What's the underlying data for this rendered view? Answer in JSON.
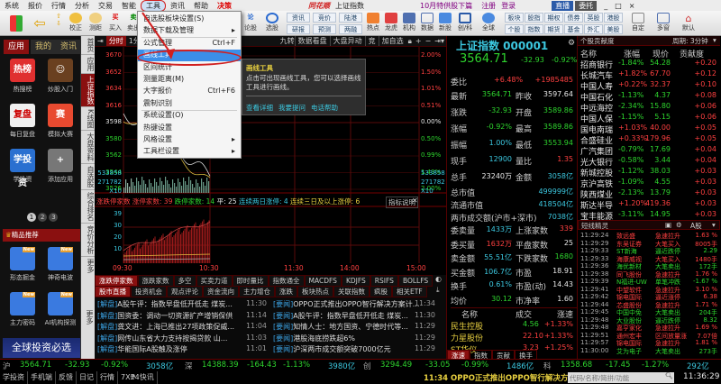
{
  "menu": {
    "items": [
      "系统",
      "报价",
      "行情",
      "分析",
      "交易",
      "智能",
      "工具",
      "资讯",
      "帮助"
    ],
    "special": "决策",
    "brand": "同花顺",
    "title": "上证指数",
    "promo": "10月特供股下篇",
    "register": "注册",
    "login": "登录",
    "live": "直播",
    "trade": "委托"
  },
  "toolbar": {
    "left": [
      "校正",
      "测距",
      "买入",
      "卖出"
    ],
    "mid1": [
      "论股",
      "选股"
    ],
    "small": [
      "资讯",
      "竞价",
      "陆港",
      "研报",
      "预测",
      "两融"
    ],
    "icons": [
      "热点",
      "龙虎",
      "机构",
      "数据",
      "新股",
      "创/科",
      "全球"
    ],
    "markets": [
      "板块",
      "股指",
      "期权",
      "债券",
      "英股",
      "港股",
      "个股",
      "指数",
      "期货",
      "基金",
      "外汇",
      "美股"
    ],
    "views": [
      "自定",
      "多窗",
      "默认"
    ]
  },
  "dropdown": {
    "items": [
      {
        "label": "自选股板块设置(S)",
        "sc": ""
      },
      {
        "label": "数据下载及管理",
        "sc": "▸"
      },
      {
        "label": "公式管理",
        "sc": "Ctrl+F"
      },
      {
        "label": "画线工具",
        "sc": ""
      },
      {
        "label": "区间统计",
        "sc": ""
      },
      {
        "label": "测量距离(M)",
        "sc": ""
      },
      {
        "label": "大字报价",
        "sc": "Ctrl+F6"
      },
      {
        "label": "震制识别",
        "sc": ""
      },
      {
        "label": "系统设置(O)",
        "sc": ""
      },
      {
        "label": "热键设置",
        "sc": ""
      },
      {
        "label": "风格设置",
        "sc": "▸"
      },
      {
        "label": "工具栏设置",
        "sc": "▸"
      }
    ]
  },
  "tooltip": {
    "title": "画线工具",
    "body": "点击可出现画线工具，您可以选择画线工具进行画线。",
    "links": [
      "查看详细",
      "我要提问",
      "电话帮助"
    ]
  },
  "left": {
    "tabs": [
      "应用",
      "我的",
      "资讯"
    ],
    "apps": [
      {
        "label": "热搜榜",
        "icon": "热榜",
        "color": "#e03030"
      },
      {
        "label": "炒股入门",
        "icon": "☺",
        "color": "#6a4020"
      },
      {
        "label": "每日复盘",
        "icon": "复盘",
        "color": "#f0f0f0"
      },
      {
        "label": "模拟大赛",
        "icon": "赛",
        "color": "#e84a30"
      },
      {
        "label": "学投资",
        "icon": "学投资",
        "color": "#2a70d0"
      },
      {
        "label": "添加应用",
        "icon": "+",
        "color": "#777"
      }
    ],
    "pages": [
      "1",
      "2",
      "3"
    ],
    "featured": "精品推荐",
    "recommend": [
      {
        "label": "形态掘金",
        "badge": "New"
      },
      {
        "label": "神奇电波",
        "badge": "New"
      },
      {
        "label": "主力密码",
        "badge": "New"
      },
      {
        "label": "AI机构探测",
        "badge": "New"
      }
    ],
    "banner": "全球投资必选"
  },
  "vtabs": [
    "首页",
    "应用",
    "上证指数",
    "K线图",
    "大盘资料",
    "自选股",
    "综合排名",
    "竞价分析",
    "更多"
  ],
  "chart": {
    "tabs": [
      "分时",
      "1分"
    ],
    "tools": [
      "九转",
      "数据看盘",
      "大盘异动",
      "竞",
      "加自选"
    ],
    "ylabels_left": [
      "3670",
      "3652",
      "3634",
      "3616",
      "3598",
      "3580",
      "3562",
      "3544",
      "3526"
    ],
    "ylabels_right": [
      "2.00%",
      "1.50%",
      "1.01%",
      "0.51%",
      "0.00%",
      "0.50%",
      "0.99%",
      "1.49%",
      "2.00%"
    ],
    "vol_labels": [
      "533858",
      "271782",
      "X10"
    ],
    "ind_labels": [
      "39",
      "30",
      "20",
      "10"
    ],
    "legend": {
      "name": "涨跌停家数",
      "up": "涨停家数: 39",
      "down": "跌停家数: 14",
      "flat": "平: 25",
      "two": "连续两日涨停: 4",
      "three": "连续三日及以上涨停: 6"
    },
    "explain": "指标说明",
    "times": [
      "09:30",
      "10:30",
      "11:30",
      "14:00",
      "15:00"
    ],
    "ind_tabs": [
      "涨跌停家数",
      "涨跌家数",
      "多空",
      "买卖力道",
      "即时量比",
      "指数通全",
      "MACDFS",
      "KDJFS",
      "RSIFS",
      "BOLLFS"
    ]
  },
  "news": {
    "side": "更多",
    "tabs_left": [
      "股市直播",
      "投资机会",
      "观点评论",
      "资金流向",
      "主力增仓",
      "短线"
    ],
    "tabs_right": [
      "涨跌",
      "板块热点",
      "关联指数",
      "疯股",
      "相关ETF"
    ],
    "left": [
      {
        "tag": "[解盘]",
        "text": "A股午评：指数早盘低开低走 煤炭...",
        "time": "11:30"
      },
      {
        "tag": "[解盘]",
        "text": "国资委：调动一切资源扩产增销保供",
        "time": "11:14"
      },
      {
        "tag": "[解盘]",
        "text": "龚文进：上海已推出27项政策促威...",
        "time": "11:04"
      },
      {
        "tag": "[解盘]",
        "text": "网传山东省大力支持按揭贷款 山...",
        "time": "11:03"
      },
      {
        "tag": "[解盘]",
        "text": "华能国际A股触及涨停",
        "time": "11:01"
      }
    ],
    "right": [
      {
        "tag": "[要闻]",
        "text": "OPPO正式推出OPPO智行解决方案计...",
        "time": "11:34"
      },
      {
        "tag": "[要闻]",
        "text": "A股午评：指数早盘低开低走 煤炭...",
        "time": "11:30"
      },
      {
        "tag": "[要闻]",
        "text": "知情人士：地方国资、宁德时代等...",
        "time": "11:29"
      },
      {
        "tag": "[要闻]",
        "text": "港股海底捞跌超6%",
        "time": "11:29"
      },
      {
        "tag": "[要闻]",
        "text": "沪深两市成交额突破7000亿元",
        "time": "11:29"
      }
    ]
  },
  "quote": {
    "name": "上证指数 000001",
    "price": "3564.71",
    "change": "-32.93",
    "pct": "-0.92%",
    "weibi": {
      "label": "委比",
      "pct": "+6.48%",
      "val": "+1985485"
    },
    "rows": [
      [
        "最新",
        "3564.71",
        "昨收",
        "3597.64"
      ],
      [
        "涨跌",
        "-32.93",
        "开盘",
        "3589.86"
      ],
      [
        "涨幅",
        "-0.92%",
        "最高",
        "3589.86"
      ],
      [
        "振幅",
        "1.00%",
        "最低",
        "3553.94"
      ],
      [
        "现手",
        "12900",
        "量比",
        "1.35"
      ],
      [
        "总手",
        "23240万",
        "金额",
        "3058亿"
      ]
    ],
    "cap": [
      [
        "总市值",
        "499999亿"
      ],
      [
        "流通市值",
        "418504亿"
      ],
      [
        "两市成交额(沪市+深市)",
        "7038亿"
      ]
    ],
    "rows2": [
      [
        "委卖量",
        "1433万",
        "上涨家数",
        "339"
      ],
      [
        "委买量",
        "1632万",
        "平盘家数",
        "25"
      ],
      [
        "卖金额",
        "55.51亿",
        "下跌家数",
        "1680"
      ],
      [
        "买金额",
        "106.7亿",
        "市盈",
        "18.91"
      ],
      [
        "换手",
        "0.61%",
        "市盈(动)",
        "14.43"
      ],
      [
        "均价",
        "30.12",
        "市净率",
        "1.60"
      ]
    ],
    "list_head": [
      "名称",
      "成交",
      "涨速"
    ],
    "list": [
      [
        "民生控股",
        "4.56",
        "+1.33%"
      ],
      [
        "力星股份",
        "22.10",
        "+1.33%"
      ],
      [
        "ST华仪",
        "3.23",
        "+1.25%"
      ]
    ],
    "bottom_tabs": [
      "涨速",
      "指数",
      "贡献",
      "换手"
    ]
  },
  "contrib": {
    "title": "个股贡献度",
    "period": "周期: 3分钟",
    "head": [
      "名称",
      "涨幅",
      "现价",
      "贡献度"
    ],
    "rows": [
      [
        "招商银行",
        "-1.84%",
        "54.28",
        "+0.20"
      ],
      [
        "长城汽车",
        "+1.82%",
        "67.70",
        "+0.12"
      ],
      [
        "中国人寿",
        "+0.22%",
        "32.37",
        "+0.10"
      ],
      [
        "中国石化",
        "-1.13%",
        "4.37",
        "+0.08"
      ],
      [
        "中远海控",
        "-2.34%",
        "15.80",
        "+0.06"
      ],
      [
        "中国人保",
        "-1.15%",
        "5.15",
        "+0.06"
      ],
      [
        "国电南瑞",
        "+1.03%",
        "40.00",
        "+0.05"
      ],
      [
        "合盛硅业",
        "+0.33%",
        "179.96",
        "+0.05"
      ],
      [
        "广汽集团",
        "-0.79%",
        "17.69",
        "+0.04"
      ],
      [
        "光大银行",
        "-0.58%",
        "3.44",
        "+0.04"
      ],
      [
        "新城控股",
        "-1.12%",
        "38.03",
        "+0.03"
      ],
      [
        "京沪高铁",
        "-1.09%",
        "4.55",
        "+0.03"
      ],
      [
        "陕西煤业",
        "-2.13%",
        "13.79",
        "+0.03"
      ],
      [
        "斯达半导",
        "+1.20%",
        "419.36",
        "+0.03"
      ],
      [
        "宝丰能源",
        "-3.11%",
        "14.95",
        "+0.03"
      ]
    ]
  },
  "spirit": {
    "title": "短线精灵",
    "market": "A股",
    "rows": [
      [
        "11:29:24",
        "致远盛",
        "急速拉升",
        "1.63 %"
      ],
      [
        "11:29:29",
        "东吴证券",
        "大笔买入",
        "8005手"
      ],
      [
        "11:29:33",
        "ST新海",
        "逼近跌停",
        "2.29"
      ],
      [
        "11:29:33",
        "海康威视",
        "大笔买入",
        "1480手"
      ],
      [
        "11:29:36",
        "海优新材",
        "大笔卖出",
        "172手"
      ],
      [
        "11:29:38",
        "同飞股份",
        "急速拉升",
        "1.76 %"
      ],
      [
        "11:29:39",
        "N福进-UW",
        "单笔冲跌",
        "-1.67 %"
      ],
      [
        "11:29:41",
        "中望软件",
        "急速拉升",
        "3.10 %"
      ],
      [
        "11:29:42",
        "锦电国际",
        "逼近涨停",
        "6.38"
      ],
      [
        "11:29:44",
        "芯盛股份",
        "急速拉升",
        "1.71 %"
      ],
      [
        "11:29:45",
        "中国中免",
        "大笔卖出",
        "204手"
      ],
      [
        "11:29:48",
        "大业股份",
        "逼近跌停",
        "8.32"
      ],
      [
        "11:29:48",
        "嘉亨家化",
        "急速拉升",
        "1.69 %"
      ],
      [
        "11:29:51",
        "通州宏丰",
        "区间放量涨",
        "7.07倍"
      ],
      [
        "11:29:57",
        "锦电国际",
        "急速拉升",
        "1.81 %"
      ],
      [
        "11:30:00",
        "艾为电子",
        "大笔卖出",
        "273手"
      ]
    ]
  },
  "status": {
    "sh": {
      "label": "沪",
      "price": "3564.71",
      "chg": "-32.93",
      "pct": "-0.92%",
      "amt": "3058亿"
    },
    "sz": {
      "label": "深",
      "price": "14388.39",
      "chg": "-164.43",
      "pct": "-1.13%",
      "amt": "3980亿"
    },
    "cy": {
      "label": "创",
      "price": "3294.49",
      "chg": "-33.05",
      "pct": "-0.99%",
      "amt": "1486亿"
    },
    "kc": {
      "label": "科",
      "price": "1358.68",
      "chg": "-17.45",
      "pct": "-1.27%",
      "amt": "292亿"
    }
  },
  "bottom": {
    "items": [
      "学投资",
      "手机端",
      "反馈",
      "日记",
      "行情",
      "7X24快讯"
    ],
    "ticker": "11:34 OPPO正式推出OPPO智行解决方案计划2025",
    "search_placeholder": "代码/名称/简拼/功能",
    "clock": "11:36:29"
  },
  "colors": {
    "up": "#ff4040",
    "down": "#2ed52e",
    "accent": "#8a1010",
    "cyan": "#3cc8e0"
  }
}
